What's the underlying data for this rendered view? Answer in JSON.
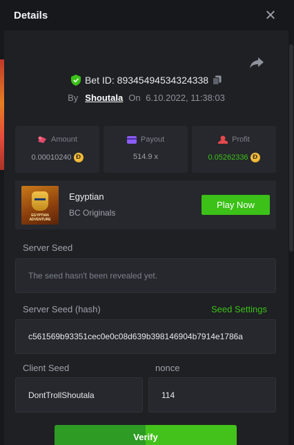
{
  "header": {
    "title": "Details"
  },
  "bet": {
    "id_label": "Bet ID: 89345494534324338",
    "by_label": "By",
    "user": "Shoutala",
    "on_label": "On",
    "datetime": "6.10.2022, 11:38:03"
  },
  "stats": {
    "amount": {
      "label": "Amount",
      "value": "0.00010240"
    },
    "payout": {
      "label": "Payout",
      "value": "514.9 x"
    },
    "profit": {
      "label": "Profit",
      "value": "0.05262336"
    }
  },
  "coin_symbol": "Ð",
  "game": {
    "name": "Egyptian",
    "provider": "BC Originals",
    "thumb_text": "EGYPTIAN ADVENTURE",
    "play_label": "Play Now"
  },
  "server_seed": {
    "label": "Server Seed",
    "placeholder": "The seed hasn't been revealed yet."
  },
  "server_seed_hash": {
    "label": "Server Seed (hash)",
    "settings_link": "Seed Settings",
    "value": "c561569b93351cec0e0c08d639b398146904b7914e1786a"
  },
  "client_seed": {
    "label": "Client Seed",
    "value": "DontTrollShoutala"
  },
  "nonce": {
    "label": "nonce",
    "value": "114"
  },
  "verify_label": "Verify",
  "colors": {
    "accent_green": "#3bc117",
    "panel": "#26282d",
    "background": "#1e2024"
  }
}
